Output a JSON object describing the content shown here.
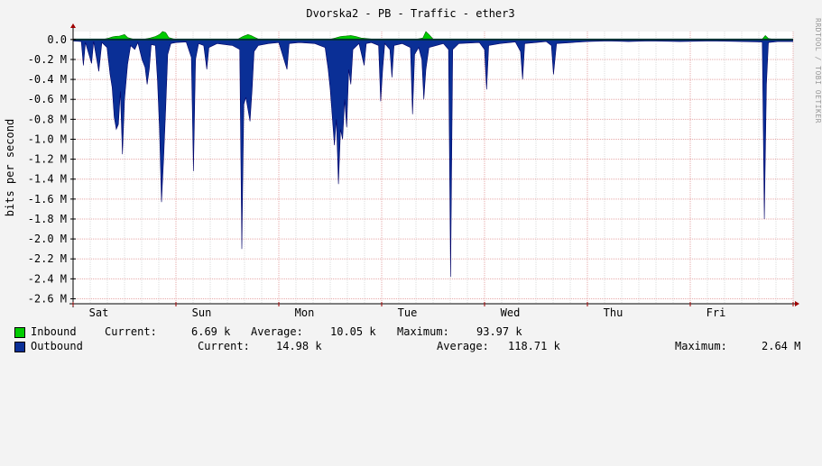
{
  "title": "Dvorska2 - PB - Traffic - ether3",
  "watermark": "RRDTOOL / TOBI OETIKER",
  "colors": {
    "inbound": "#00cc00",
    "outbound": "#0a2f96",
    "inbound_line": "#006600",
    "outbound_line": "#000066",
    "grid_minor": "#dcdcdc",
    "grid_major": "#e6a8a8",
    "canvas": "#ffffff",
    "background": "#f3f3f3"
  },
  "chart_data": {
    "type": "area",
    "title": "Dvorska2 - PB - Traffic - ether3",
    "ylabel": "bits per second",
    "xlabel": "",
    "ylim": [
      -2650000,
      80000
    ],
    "y_ticks": [
      {
        "v": 0,
        "label": "0.0"
      },
      {
        "v": -200000,
        "label": "-0.2 M"
      },
      {
        "v": -400000,
        "label": "-0.4 M"
      },
      {
        "v": -600000,
        "label": "-0.6 M"
      },
      {
        "v": -800000,
        "label": "-0.8 M"
      },
      {
        "v": -1000000,
        "label": "-1.0 M"
      },
      {
        "v": -1200000,
        "label": "-1.2 M"
      },
      {
        "v": -1400000,
        "label": "-1.4 M"
      },
      {
        "v": -1600000,
        "label": "-1.6 M"
      },
      {
        "v": -1800000,
        "label": "-1.8 M"
      },
      {
        "v": -2000000,
        "label": "-2.0 M"
      },
      {
        "v": -2200000,
        "label": "-2.2 M"
      },
      {
        "v": -2400000,
        "label": "-2.4 M"
      },
      {
        "v": -2600000,
        "label": "-2.6 M"
      }
    ],
    "xlim": [
      0,
      7
    ],
    "x_ticks": [
      {
        "v": 0.25,
        "label": "Sat"
      },
      {
        "v": 1.25,
        "label": "Sun"
      },
      {
        "v": 2.25,
        "label": "Mon"
      },
      {
        "v": 3.25,
        "label": "Tue"
      },
      {
        "v": 4.25,
        "label": "Wed"
      },
      {
        "v": 5.25,
        "label": "Thu"
      },
      {
        "v": 6.25,
        "label": "Fri"
      }
    ],
    "x_unit": "days",
    "grid": true,
    "series": [
      {
        "name": "Inbound",
        "values_note": "",
        "points": [
          [
            0.0,
            2000
          ],
          [
            0.1,
            3000
          ],
          [
            0.2,
            5000
          ],
          [
            0.3,
            3000
          ],
          [
            0.35,
            15000
          ],
          [
            0.38,
            25000
          ],
          [
            0.4,
            30000
          ],
          [
            0.45,
            35000
          ],
          [
            0.5,
            50000
          ],
          [
            0.53,
            20000
          ],
          [
            0.58,
            5000
          ],
          [
            0.65,
            3000
          ],
          [
            0.7,
            5000
          ],
          [
            0.75,
            15000
          ],
          [
            0.8,
            30000
          ],
          [
            0.84,
            50000
          ],
          [
            0.87,
            80000
          ],
          [
            0.9,
            70000
          ],
          [
            0.93,
            20000
          ],
          [
            0.98,
            5000
          ],
          [
            1.1,
            3000
          ],
          [
            1.2,
            5000
          ],
          [
            1.3,
            4000
          ],
          [
            1.45,
            3000
          ],
          [
            1.6,
            2000
          ],
          [
            1.65,
            30000
          ],
          [
            1.7,
            50000
          ],
          [
            1.73,
            40000
          ],
          [
            1.76,
            25000
          ],
          [
            1.8,
            5000
          ],
          [
            1.9,
            3000
          ],
          [
            2.1,
            2000
          ],
          [
            2.3,
            2000
          ],
          [
            2.5,
            3000
          ],
          [
            2.55,
            15000
          ],
          [
            2.6,
            30000
          ],
          [
            2.65,
            35000
          ],
          [
            2.7,
            40000
          ],
          [
            2.75,
            30000
          ],
          [
            2.8,
            15000
          ],
          [
            2.85,
            10000
          ],
          [
            2.9,
            5000
          ],
          [
            3.0,
            3000
          ],
          [
            3.2,
            3000
          ],
          [
            3.35,
            5000
          ],
          [
            3.4,
            15000
          ],
          [
            3.43,
            80000
          ],
          [
            3.46,
            50000
          ],
          [
            3.5,
            5000
          ],
          [
            3.6,
            3000
          ],
          [
            3.8,
            2000
          ],
          [
            4.0,
            3000
          ],
          [
            4.2,
            2000
          ],
          [
            4.5,
            3000
          ],
          [
            4.8,
            2000
          ],
          [
            5.0,
            2000
          ],
          [
            5.4,
            2000
          ],
          [
            5.8,
            3000
          ],
          [
            6.2,
            2000
          ],
          [
            6.5,
            2000
          ],
          [
            6.7,
            3000
          ],
          [
            6.73,
            40000
          ],
          [
            6.76,
            10000
          ],
          [
            6.8,
            2000
          ],
          [
            7.0,
            2000
          ]
        ]
      },
      {
        "name": "Outbound",
        "values_note": "",
        "points": [
          [
            0.0,
            -15000
          ],
          [
            0.08,
            -20000
          ],
          [
            0.1,
            -260000
          ],
          [
            0.12,
            -30000
          ],
          [
            0.18,
            -240000
          ],
          [
            0.2,
            -20000
          ],
          [
            0.25,
            -320000
          ],
          [
            0.28,
            -30000
          ],
          [
            0.33,
            -80000
          ],
          [
            0.36,
            -350000
          ],
          [
            0.38,
            -480000
          ],
          [
            0.4,
            -780000
          ],
          [
            0.42,
            -900000
          ],
          [
            0.44,
            -850000
          ],
          [
            0.46,
            -520000
          ],
          [
            0.48,
            -1150000
          ],
          [
            0.5,
            -600000
          ],
          [
            0.53,
            -250000
          ],
          [
            0.56,
            -60000
          ],
          [
            0.6,
            -100000
          ],
          [
            0.63,
            -30000
          ],
          [
            0.67,
            -200000
          ],
          [
            0.7,
            -280000
          ],
          [
            0.72,
            -450000
          ],
          [
            0.74,
            -300000
          ],
          [
            0.76,
            -50000
          ],
          [
            0.8,
            -60000
          ],
          [
            0.82,
            -400000
          ],
          [
            0.84,
            -900000
          ],
          [
            0.86,
            -1630000
          ],
          [
            0.88,
            -1200000
          ],
          [
            0.9,
            -700000
          ],
          [
            0.92,
            -150000
          ],
          [
            0.95,
            -40000
          ],
          [
            1.0,
            -30000
          ],
          [
            1.1,
            -25000
          ],
          [
            1.15,
            -180000
          ],
          [
            1.17,
            -1320000
          ],
          [
            1.19,
            -200000
          ],
          [
            1.22,
            -40000
          ],
          [
            1.27,
            -60000
          ],
          [
            1.3,
            -300000
          ],
          [
            1.32,
            -80000
          ],
          [
            1.4,
            -40000
          ],
          [
            1.55,
            -60000
          ],
          [
            1.62,
            -100000
          ],
          [
            1.64,
            -2100000
          ],
          [
            1.66,
            -650000
          ],
          [
            1.68,
            -580000
          ],
          [
            1.7,
            -700000
          ],
          [
            1.72,
            -820000
          ],
          [
            1.74,
            -500000
          ],
          [
            1.76,
            -120000
          ],
          [
            1.8,
            -60000
          ],
          [
            1.9,
            -40000
          ],
          [
            2.0,
            -30000
          ],
          [
            2.08,
            -300000
          ],
          [
            2.1,
            -40000
          ],
          [
            2.2,
            -30000
          ],
          [
            2.35,
            -40000
          ],
          [
            2.45,
            -80000
          ],
          [
            2.48,
            -300000
          ],
          [
            2.5,
            -500000
          ],
          [
            2.52,
            -780000
          ],
          [
            2.54,
            -1060000
          ],
          [
            2.56,
            -800000
          ],
          [
            2.58,
            -1450000
          ],
          [
            2.6,
            -900000
          ],
          [
            2.62,
            -1000000
          ],
          [
            2.64,
            -600000
          ],
          [
            2.66,
            -880000
          ],
          [
            2.68,
            -300000
          ],
          [
            2.7,
            -450000
          ],
          [
            2.72,
            -100000
          ],
          [
            2.78,
            -40000
          ],
          [
            2.83,
            -260000
          ],
          [
            2.85,
            -40000
          ],
          [
            2.9,
            -30000
          ],
          [
            2.97,
            -60000
          ],
          [
            2.99,
            -620000
          ],
          [
            3.01,
            -300000
          ],
          [
            3.03,
            -40000
          ],
          [
            3.08,
            -100000
          ],
          [
            3.1,
            -380000
          ],
          [
            3.12,
            -60000
          ],
          [
            3.2,
            -40000
          ],
          [
            3.28,
            -80000
          ],
          [
            3.3,
            -750000
          ],
          [
            3.32,
            -150000
          ],
          [
            3.36,
            -80000
          ],
          [
            3.39,
            -200000
          ],
          [
            3.41,
            -600000
          ],
          [
            3.43,
            -300000
          ],
          [
            3.46,
            -80000
          ],
          [
            3.6,
            -40000
          ],
          [
            3.65,
            -100000
          ],
          [
            3.67,
            -2380000
          ],
          [
            3.69,
            -100000
          ],
          [
            3.75,
            -40000
          ],
          [
            3.95,
            -30000
          ],
          [
            4.0,
            -100000
          ],
          [
            4.02,
            -500000
          ],
          [
            4.04,
            -60000
          ],
          [
            4.15,
            -40000
          ],
          [
            4.3,
            -25000
          ],
          [
            4.35,
            -120000
          ],
          [
            4.37,
            -400000
          ],
          [
            4.39,
            -40000
          ],
          [
            4.5,
            -30000
          ],
          [
            4.6,
            -20000
          ],
          [
            4.65,
            -60000
          ],
          [
            4.67,
            -350000
          ],
          [
            4.7,
            -40000
          ],
          [
            5.0,
            -20000
          ],
          [
            5.2,
            -15000
          ],
          [
            5.4,
            -20000
          ],
          [
            5.6,
            -15000
          ],
          [
            5.9,
            -20000
          ],
          [
            6.2,
            -15000
          ],
          [
            6.5,
            -20000
          ],
          [
            6.7,
            -25000
          ],
          [
            6.72,
            -1800000
          ],
          [
            6.74,
            -450000
          ],
          [
            6.76,
            -30000
          ],
          [
            6.85,
            -20000
          ],
          [
            7.0,
            -20000
          ]
        ]
      }
    ]
  },
  "legend": {
    "inbound": {
      "name": "Inbound",
      "current_label": "Current:",
      "current_value": "6.69 k",
      "average_label": "Average:",
      "average_value": "10.05 k",
      "maximum_label": "Maximum:",
      "maximum_value": "93.97 k"
    },
    "outbound": {
      "name": "Outbound",
      "current_label": "Current:",
      "current_value": "14.98 k",
      "average_label": "Average:",
      "average_value": "118.71 k",
      "maximum_label": "Maximum:",
      "maximum_value": "2.64 M"
    }
  }
}
